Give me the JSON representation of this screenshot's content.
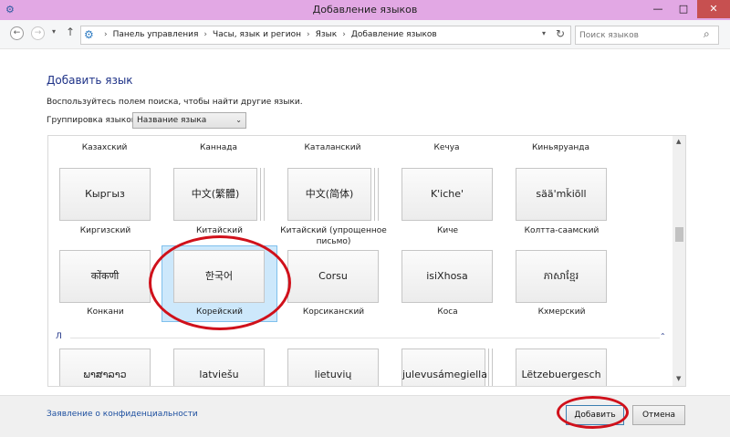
{
  "window": {
    "title": "Добавление языков",
    "minimize_icon": "minimize-icon",
    "maximize_icon": "maximize-icon",
    "close_icon": "close-icon",
    "close_color": "#c75050"
  },
  "navigation": {
    "breadcrumbs": [
      "Панель управления",
      "Часы, язык и регион",
      "Язык",
      "Добавление языков"
    ],
    "search_placeholder": "Поиск языков"
  },
  "content": {
    "heading": "Добавить язык",
    "hint": "Воспользуйтесь полем поиска, чтобы найти другие языки.",
    "group_label": "Группировка языков:",
    "group_value": "Название языка",
    "top_labels": [
      "Казахский",
      "Каннада",
      "Каталанский",
      "Кечуа",
      "Киньяруанда"
    ],
    "rows": [
      [
        {
          "native": "Кыргыз",
          "name": "Киргизский"
        },
        {
          "native": "中文(繁體)",
          "name": "Китайский (традиционное письмо)"
        },
        {
          "native": "中文(简体)",
          "name": "Китайский (упрощенное письмо)"
        },
        {
          "native": "K'iche'",
          "name": "Киче"
        },
        {
          "native": "sää'mǩiõll",
          "name": "Колтта-саамский"
        }
      ],
      [
        {
          "native": "कोंकणी",
          "name": "Конкани"
        },
        {
          "native": "한국어",
          "name": "Корейский",
          "selected": true
        },
        {
          "native": "Corsu",
          "name": "Корсиканский"
        },
        {
          "native": "isiXhosa",
          "name": "Коса"
        },
        {
          "native": "ភាសាខ្មែរ",
          "name": "Кхмерский"
        }
      ]
    ],
    "section_letter": "Л",
    "bottom_row": [
      "ພາສາລາວ",
      "latviešu",
      "lietuvių",
      "julevusámegiella",
      "Lëtzebuergesch"
    ]
  },
  "footer": {
    "privacy_link": "Заявление о конфиденциальности",
    "add_button": "Добавить",
    "cancel_button": "Отмена"
  },
  "colors": {
    "titlebar": "#e2a8e4",
    "heading": "#1e3287",
    "selection": "#cde8fb",
    "annotation": "#d0111b"
  }
}
